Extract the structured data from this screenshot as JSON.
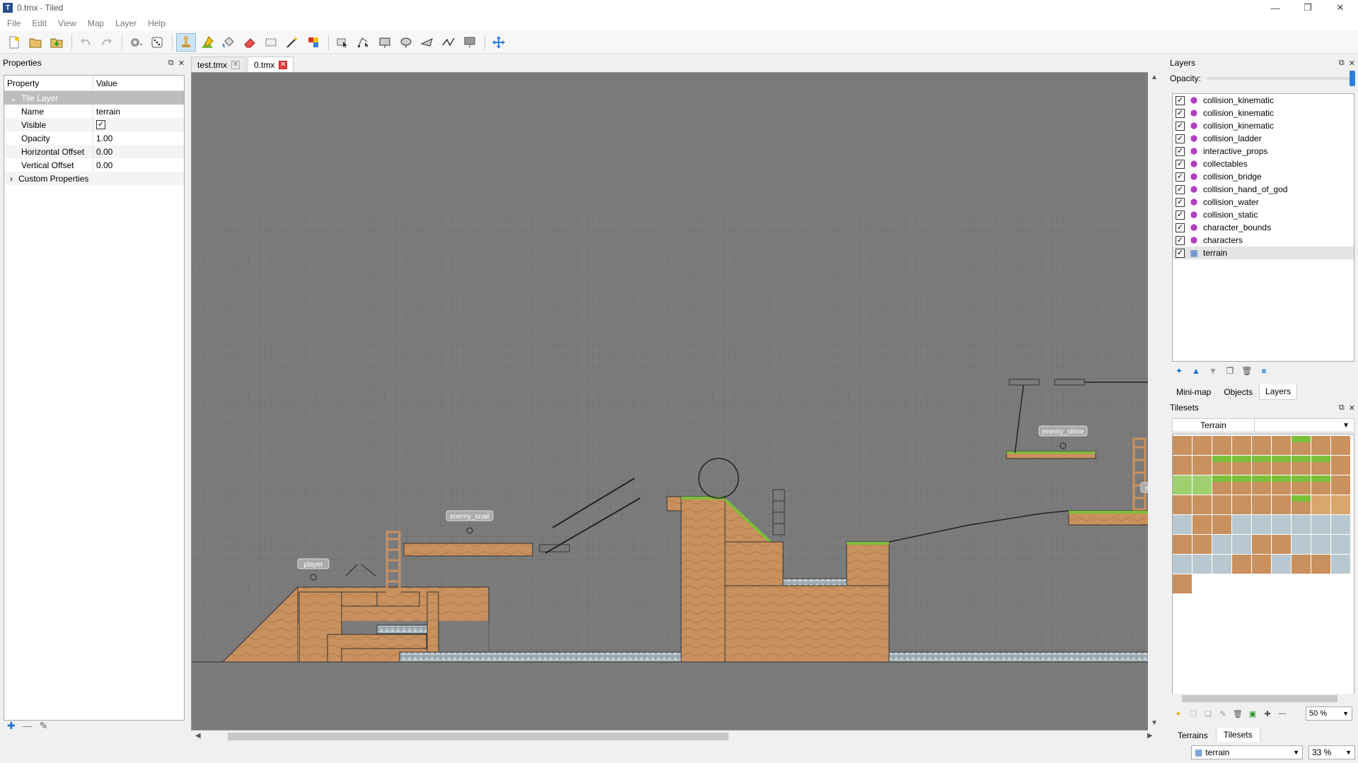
{
  "window": {
    "title": "0.tmx - Tiled",
    "app_icon": "T"
  },
  "menu": [
    "File",
    "Edit",
    "View",
    "Map",
    "Layer",
    "Help"
  ],
  "properties_panel": {
    "title": "Properties",
    "col_property": "Property",
    "col_value": "Value",
    "group": "Tile Layer",
    "rows": [
      {
        "name": "Name",
        "value": "terrain"
      },
      {
        "name": "Visible",
        "value": "✓"
      },
      {
        "name": "Opacity",
        "value": "1.00"
      },
      {
        "name": "Horizontal Offset",
        "value": "0.00"
      },
      {
        "name": "Vertical Offset",
        "value": "0.00"
      }
    ],
    "custom": "Custom Properties"
  },
  "tabs": [
    {
      "label": "test.tmx",
      "active": false
    },
    {
      "label": "0.tmx",
      "active": true
    }
  ],
  "map_labels": {
    "player": "player",
    "enemy_snail": "enemy_snail",
    "enemy_slime": "enemy_slime",
    "enemy_cut": "ene"
  },
  "layers_panel": {
    "title": "Layers",
    "opacity_label": "Opacity:",
    "opacity": 1.0,
    "layers": [
      {
        "name": "collision_kinematic",
        "type": "object"
      },
      {
        "name": "collision_kinematic",
        "type": "object"
      },
      {
        "name": "collision_kinematic",
        "type": "object"
      },
      {
        "name": "collision_ladder",
        "type": "object"
      },
      {
        "name": "interactive_props",
        "type": "object"
      },
      {
        "name": "collectables",
        "type": "object"
      },
      {
        "name": "collision_bridge",
        "type": "object"
      },
      {
        "name": "collision_hand_of_god",
        "type": "object"
      },
      {
        "name": "collision_water",
        "type": "object"
      },
      {
        "name": "collision_static",
        "type": "object"
      },
      {
        "name": "character_bounds",
        "type": "object"
      },
      {
        "name": "characters",
        "type": "object"
      },
      {
        "name": "terrain",
        "type": "tile",
        "selected": true
      }
    ],
    "tabs": [
      "Mini-map",
      "Objects",
      "Layers"
    ],
    "active_tab": "Layers"
  },
  "tilesets_panel": {
    "title": "Tilesets",
    "tileset_name": "Terrain",
    "zoom": "50 %"
  },
  "bottom_tabs": [
    "Terrains",
    "Tilesets"
  ],
  "status": {
    "layer": "terrain",
    "zoom": "33 %"
  },
  "colors": {
    "dirt": "#c8915e",
    "grass": "#7bbf3a",
    "canvas": "#7b7b7b",
    "accent": "#2a7fe0"
  }
}
